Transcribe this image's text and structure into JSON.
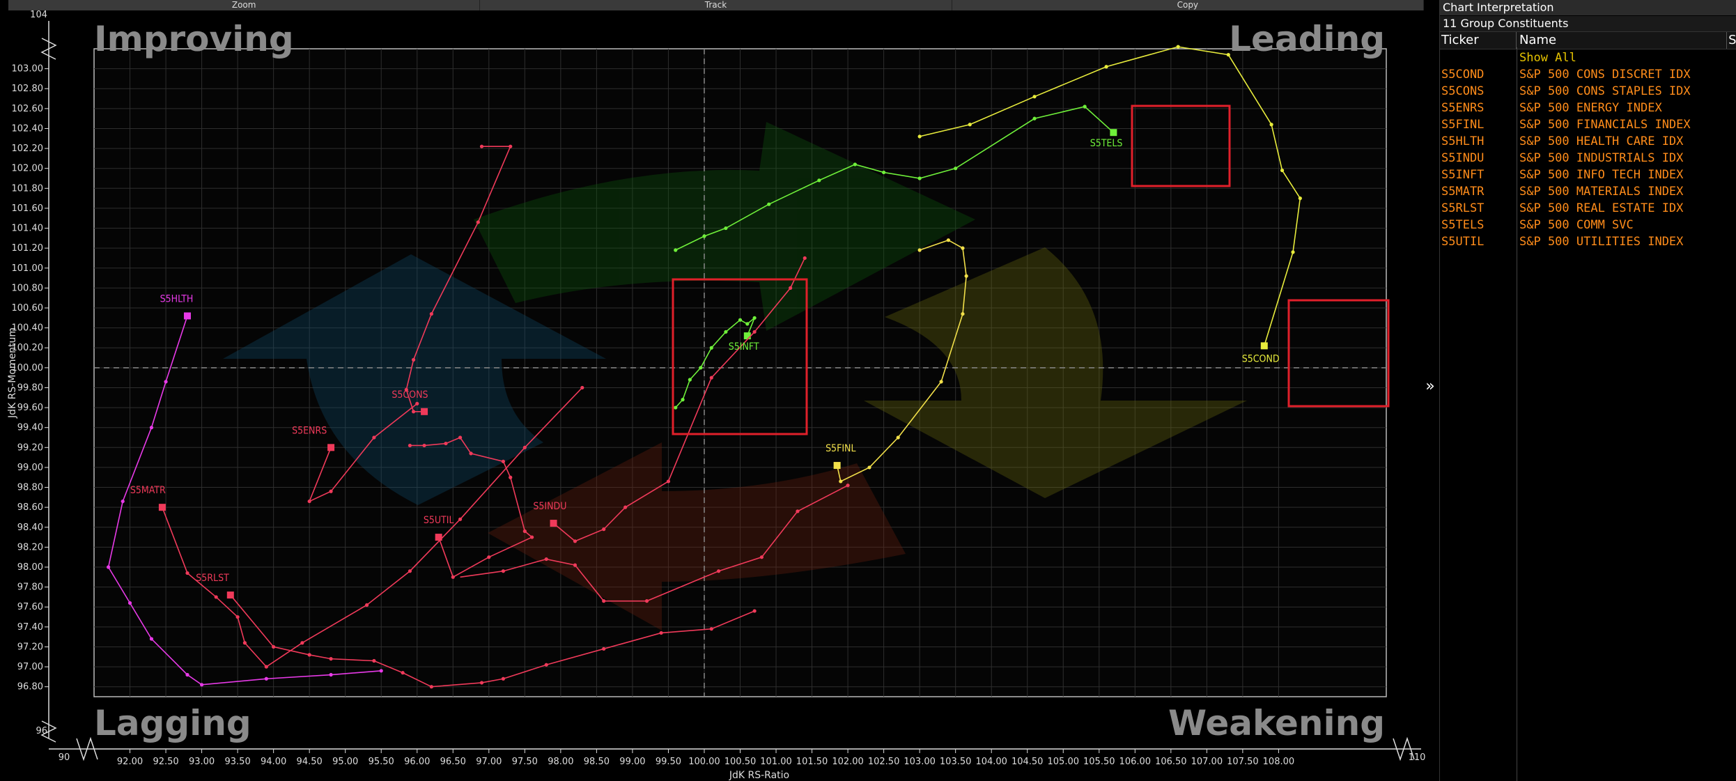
{
  "toolbar": {
    "zoom": "Zoom",
    "track": "Track",
    "copy": "Copy"
  },
  "panel": {
    "title": "Chart Interpretation",
    "subtitle": "11 Group Constituents",
    "col_ticker": "Ticker",
    "col_name": "Name",
    "col_extra": "S",
    "show_all": "Show All",
    "rows": [
      {
        "ticker": "S5COND",
        "name": "S&P 500 CONS DISCRET IDX"
      },
      {
        "ticker": "S5CONS",
        "name": "S&P 500 CONS STAPLES IDX"
      },
      {
        "ticker": "S5ENRS",
        "name": "S&P 500 ENERGY INDEX"
      },
      {
        "ticker": "S5FINL",
        "name": "S&P 500 FINANCIALS INDEX"
      },
      {
        "ticker": "S5HLTH",
        "name": "S&P 500 HEALTH CARE IDX"
      },
      {
        "ticker": "S5INDU",
        "name": "S&P 500 INDUSTRIALS IDX"
      },
      {
        "ticker": "S5INFT",
        "name": "S&P 500 INFO TECH INDEX"
      },
      {
        "ticker": "S5MATR",
        "name": "S&P 500 MATERIALS INDEX"
      },
      {
        "ticker": "S5RLST",
        "name": "S&P 500 REAL ESTATE IDX"
      },
      {
        "ticker": "S5TELS",
        "name": "S&P 500 COMM SVC"
      },
      {
        "ticker": "S5UTIL",
        "name": "S&P 500 UTILITIES INDEX"
      }
    ]
  },
  "chart_data": {
    "type": "scatter",
    "xlabel": "JdK RS-Ratio",
    "ylabel": "JdK RS-Momentum",
    "xlim": [
      91.5,
      109.5
    ],
    "ylim": [
      96.7,
      103.2
    ],
    "x_ticks": [
      "92.00",
      "92.50",
      "93.00",
      "93.50",
      "94.00",
      "94.50",
      "95.00",
      "95.50",
      "96.00",
      "96.50",
      "97.00",
      "97.50",
      "98.00",
      "98.50",
      "99.00",
      "99.50",
      "100.00",
      "100.50",
      "101.00",
      "101.50",
      "102.00",
      "102.50",
      "103.00",
      "103.50",
      "104.00",
      "104.50",
      "105.00",
      "105.50",
      "106.00",
      "106.50",
      "107.00",
      "107.50",
      "108.00"
    ],
    "y_ticks": [
      "96.80",
      "97.00",
      "97.20",
      "97.40",
      "97.60",
      "97.80",
      "98.00",
      "98.20",
      "98.40",
      "98.60",
      "98.80",
      "99.00",
      "99.20",
      "99.40",
      "99.60",
      "99.80",
      "100.00",
      "100.20",
      "100.40",
      "100.60",
      "100.80",
      "101.00",
      "101.20",
      "101.40",
      "101.60",
      "101.80",
      "102.00",
      "102.20",
      "102.40",
      "102.60",
      "102.80",
      "103.00"
    ],
    "x_axis_break_min": "90",
    "x_axis_break_max": "110",
    "y_axis_break_min": "96",
    "y_axis_break_max": "104",
    "quadrants": {
      "top_left": "Improving",
      "top_right": "Leading",
      "bottom_left": "Lagging",
      "bottom_right": "Weakening"
    },
    "center": [
      100,
      100
    ],
    "grid": true,
    "series": [
      {
        "name": "S5COND",
        "color": "#e8ec3c",
        "points": [
          [
            103,
            102.32
          ],
          [
            103.7,
            102.44
          ],
          [
            104.6,
            102.72
          ],
          [
            105.6,
            103.02
          ],
          [
            106.6,
            103.22
          ],
          [
            107.3,
            103.14
          ],
          [
            107.9,
            102.44
          ],
          [
            108.05,
            101.98
          ],
          [
            108.3,
            101.7
          ],
          [
            108.2,
            101.16
          ],
          [
            107.8,
            100.22
          ]
        ]
      },
      {
        "name": "S5TELS",
        "color": "#6ff03a",
        "points": [
          [
            99.6,
            101.18
          ],
          [
            100.0,
            101.32
          ],
          [
            100.3,
            101.4
          ],
          [
            100.9,
            101.64
          ],
          [
            101.6,
            101.88
          ],
          [
            102.1,
            102.04
          ],
          [
            102.5,
            101.96
          ],
          [
            103.0,
            101.9
          ],
          [
            103.5,
            102.0
          ],
          [
            104.6,
            102.5
          ],
          [
            105.3,
            102.62
          ],
          [
            105.7,
            102.36
          ]
        ]
      },
      {
        "name": "S5INFT",
        "color": "#6ff03a",
        "points": [
          [
            99.6,
            99.6
          ],
          [
            99.7,
            99.68
          ],
          [
            99.8,
            99.88
          ],
          [
            99.95,
            100.0
          ],
          [
            100.1,
            100.2
          ],
          [
            100.3,
            100.36
          ],
          [
            100.5,
            100.48
          ],
          [
            100.6,
            100.44
          ],
          [
            100.7,
            100.5
          ],
          [
            100.6,
            100.32
          ]
        ]
      },
      {
        "name": "S5FINL",
        "color": "#f2e04a",
        "points": [
          [
            103.0,
            101.18
          ],
          [
            103.4,
            101.28
          ],
          [
            103.6,
            101.2
          ],
          [
            103.65,
            100.92
          ],
          [
            103.6,
            100.54
          ],
          [
            103.3,
            99.86
          ],
          [
            102.7,
            99.3
          ],
          [
            102.3,
            99.0
          ],
          [
            101.9,
            98.86
          ],
          [
            101.85,
            99.02
          ]
        ]
      },
      {
        "name": "S5CONS",
        "color": "#f03a5a",
        "points": [
          [
            96.9,
            102.22
          ],
          [
            97.3,
            102.22
          ],
          [
            96.85,
            101.46
          ],
          [
            96.2,
            100.54
          ],
          [
            95.95,
            100.08
          ],
          [
            95.85,
            99.78
          ],
          [
            95.95,
            99.56
          ],
          [
            96.1,
            99.56
          ]
        ]
      },
      {
        "name": "S5ENRS",
        "color": "#f03a5a",
        "points": [
          [
            96.0,
            99.64
          ],
          [
            95.4,
            99.3
          ],
          [
            94.8,
            98.76
          ],
          [
            94.5,
            98.66
          ],
          [
            94.8,
            99.2
          ]
        ]
      },
      {
        "name": "S5UTIL",
        "color": "#f03a5a",
        "points": [
          [
            95.9,
            99.22
          ],
          [
            96.1,
            99.22
          ],
          [
            96.4,
            99.24
          ],
          [
            96.6,
            99.3
          ],
          [
            96.75,
            99.14
          ],
          [
            97.2,
            99.06
          ],
          [
            97.3,
            98.9
          ],
          [
            97.5,
            98.36
          ],
          [
            97.6,
            98.3
          ],
          [
            97.0,
            98.1
          ],
          [
            96.5,
            97.9
          ],
          [
            96.3,
            98.3
          ]
        ]
      },
      {
        "name": "S5INDU",
        "color": "#f03a5a",
        "points": [
          [
            101.4,
            101.1
          ],
          [
            101.2,
            100.8
          ],
          [
            100.7,
            100.36
          ],
          [
            100.1,
            99.9
          ],
          [
            99.5,
            98.86
          ],
          [
            98.9,
            98.6
          ],
          [
            98.6,
            98.38
          ],
          [
            98.2,
            98.26
          ],
          [
            97.9,
            98.44
          ]
        ]
      },
      {
        "name": "S5MATR",
        "color": "#f03a5a",
        "points": [
          [
            98.3,
            99.8
          ],
          [
            97.5,
            99.2
          ],
          [
            96.6,
            98.48
          ],
          [
            95.9,
            97.96
          ],
          [
            95.3,
            97.62
          ],
          [
            94.4,
            97.24
          ],
          [
            93.9,
            97.0
          ],
          [
            93.6,
            97.24
          ],
          [
            93.5,
            97.5
          ],
          [
            93.2,
            97.7
          ],
          [
            92.8,
            97.94
          ],
          [
            92.45,
            98.6
          ]
        ]
      },
      {
        "name": "S5RLST",
        "color": "#f03a5a",
        "points": [
          [
            100.7,
            97.56
          ],
          [
            100.1,
            97.38
          ],
          [
            99.4,
            97.34
          ],
          [
            98.6,
            97.18
          ],
          [
            97.8,
            97.02
          ],
          [
            97.2,
            96.88
          ],
          [
            96.9,
            96.84
          ],
          [
            96.2,
            96.8
          ],
          [
            95.8,
            96.94
          ],
          [
            95.4,
            97.06
          ],
          [
            94.8,
            97.08
          ],
          [
            94.5,
            97.12
          ],
          [
            94.0,
            97.2
          ],
          [
            93.4,
            97.72
          ]
        ]
      },
      {
        "name": "S5HLTH",
        "color": "#e83ae8",
        "points": [
          [
            95.5,
            96.96
          ],
          [
            94.8,
            96.92
          ],
          [
            93.9,
            96.88
          ],
          [
            93.0,
            96.82
          ],
          [
            92.8,
            96.92
          ],
          [
            92.3,
            97.28
          ],
          [
            92.0,
            97.64
          ],
          [
            91.7,
            98.0
          ],
          [
            91.9,
            98.66
          ],
          [
            92.3,
            99.4
          ],
          [
            92.5,
            99.86
          ],
          [
            92.8,
            100.52
          ]
        ]
      },
      {
        "name": "S5INDU_B",
        "color": "#f03a5a",
        "points": [
          [
            102.0,
            98.82
          ],
          [
            101.3,
            98.56
          ],
          [
            100.8,
            98.1
          ],
          [
            100.2,
            97.96
          ],
          [
            99.2,
            97.66
          ],
          [
            98.6,
            97.66
          ],
          [
            98.2,
            98.02
          ],
          [
            97.8,
            98.08
          ],
          [
            97.2,
            97.96
          ],
          [
            96.6,
            97.9
          ]
        ]
      }
    ],
    "labels": [
      {
        "text": "S5COND",
        "x": 107.75,
        "y": 100.06,
        "color": "#e8ec3c"
      },
      {
        "text": "S5TELS",
        "x": 105.6,
        "y": 102.22,
        "color": "#6ff03a"
      },
      {
        "text": "S5INFT",
        "x": 100.55,
        "y": 100.18,
        "color": "#6ff03a"
      },
      {
        "text": "S5FINL",
        "x": 101.9,
        "y": 99.16,
        "color": "#f2e04a"
      },
      {
        "text": "S5CONS",
        "x": 95.9,
        "y": 99.7,
        "color": "#f03a5a"
      },
      {
        "text": "S5ENRS",
        "x": 94.5,
        "y": 99.34,
        "color": "#f03a5a"
      },
      {
        "text": "S5UTIL",
        "x": 96.3,
        "y": 98.44,
        "color": "#f03a5a"
      },
      {
        "text": "S5INDU",
        "x": 97.85,
        "y": 98.58,
        "color": "#f03a5a"
      },
      {
        "text": "S5MATR",
        "x": 92.25,
        "y": 98.74,
        "color": "#f03a5a"
      },
      {
        "text": "S5RLST",
        "x": 93.15,
        "y": 97.86,
        "color": "#f03a5a"
      },
      {
        "text": "S5HLTH",
        "x": 92.65,
        "y": 100.66,
        "color": "#e83ae8"
      }
    ]
  }
}
